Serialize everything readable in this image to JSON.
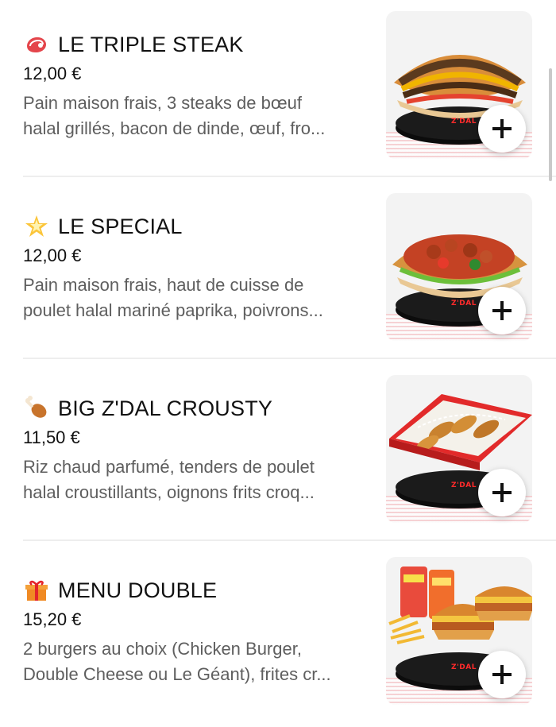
{
  "items": [
    {
      "emoji": "steak-icon",
      "name": "LE TRIPLE STEAK",
      "price": "12,00 €",
      "desc_line1": "Pain maison frais, 3 steaks de bœuf",
      "desc_line2": "halal grillés, bacon de dinde, œuf, fro...",
      "image": "triple-steak-photo"
    },
    {
      "emoji": "star-icon",
      "name": "LE SPECIAL",
      "price": "12,00 €",
      "desc_line1": "Pain maison frais, haut de cuisse de",
      "desc_line2": "poulet halal mariné paprika, poivrons...",
      "image": "special-photo"
    },
    {
      "emoji": "chicken-leg-icon",
      "name": "BIG Z'DAL CROUSTY",
      "price": "11,50 €",
      "desc_line1": "Riz chaud parfumé, tenders de poulet",
      "desc_line2": "halal croustillants, oignons frits croq...",
      "image": "crousty-photo"
    },
    {
      "emoji": "gift-icon",
      "name": "MENU DOUBLE",
      "price": "15,20 €",
      "desc_line1": "2 burgers au choix (Chicken Burger,",
      "desc_line2": "Double Cheese ou Le Géant), frites cr...",
      "image": "menu-double-photo"
    }
  ],
  "badge_text": "Z'DAL",
  "colors": {
    "accent": "#e21f26",
    "text": "#111111",
    "muted": "#5e5e5e",
    "divider": "#eeeeee"
  }
}
